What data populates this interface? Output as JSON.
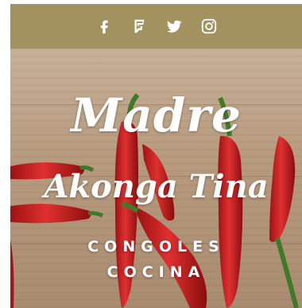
{
  "social": {
    "items": [
      {
        "name": "facebook-icon"
      },
      {
        "name": "foursquare-icon"
      },
      {
        "name": "twitter-icon"
      },
      {
        "name": "instagram-icon"
      }
    ]
  },
  "hero": {
    "title_line1": "Madre",
    "title_line2": "Akonga Tina",
    "subtitle_line1": "CONGOLES",
    "subtitle_line2": "COCINA"
  },
  "colors": {
    "topbar": "#a2925f",
    "text": "#ffffff",
    "pepper": "#c81e1e",
    "stem": "#3f7a2a"
  }
}
